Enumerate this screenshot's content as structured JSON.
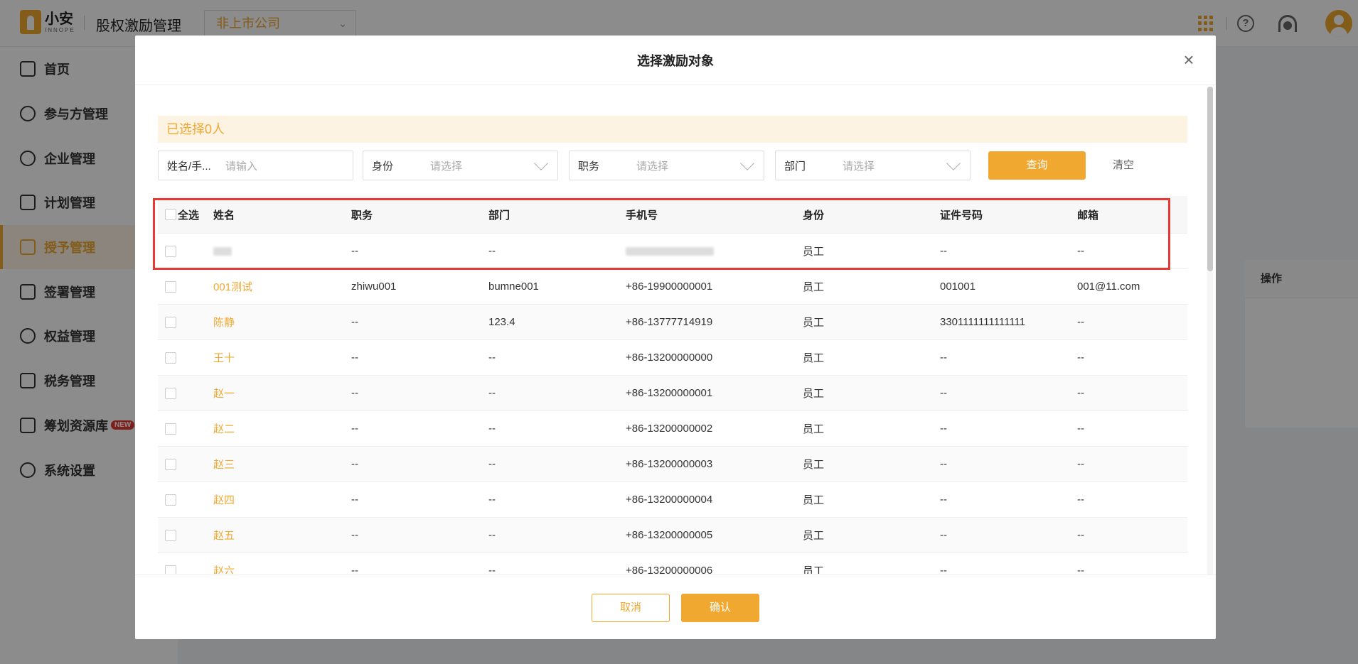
{
  "app": {
    "logo_cn": "小安",
    "logo_en": "INNOPE",
    "title": "股权激励管理",
    "company": "非上市公司"
  },
  "sidebar": {
    "items": [
      {
        "label": "首页"
      },
      {
        "label": "参与方管理"
      },
      {
        "label": "企业管理"
      },
      {
        "label": "计划管理"
      },
      {
        "label": "授予管理",
        "active": true
      },
      {
        "label": "签署管理"
      },
      {
        "label": "权益管理"
      },
      {
        "label": "税务管理"
      },
      {
        "label": "筹划资源库",
        "badge": "NEW"
      },
      {
        "label": "系统设置"
      }
    ]
  },
  "background": {
    "operation_header": "操作"
  },
  "modal": {
    "title": "选择激励对象",
    "selected_text": "已选择0人",
    "filters": {
      "name": {
        "label": "姓名/手...",
        "placeholder": "请输入"
      },
      "identity": {
        "label": "身份",
        "placeholder": "请选择"
      },
      "position": {
        "label": "职务",
        "placeholder": "请选择"
      },
      "department": {
        "label": "部门",
        "placeholder": "请选择"
      }
    },
    "query_button": "查询",
    "clear_button": "清空",
    "table": {
      "headers": {
        "select_all": "全选",
        "name": "姓名",
        "position": "职务",
        "department": "部门",
        "phone": "手机号",
        "identity": "身份",
        "id_number": "证件号码",
        "email": "邮箱"
      },
      "rows": [
        {
          "name": "",
          "position": "--",
          "department": "--",
          "phone": "",
          "identity": "员工",
          "id_number": "--",
          "email": "--",
          "redacted": true
        },
        {
          "name": "001测试",
          "position": "zhiwu001",
          "department": "bumne001",
          "phone": "+86-19900000001",
          "identity": "员工",
          "id_number": "001001",
          "email": "001@11.com"
        },
        {
          "name": "陈静",
          "position": "--",
          "department": "123.4",
          "phone": "+86-13777714919",
          "identity": "员工",
          "id_number": "3301111111111111",
          "email": "--"
        },
        {
          "name": "王十",
          "position": "--",
          "department": "--",
          "phone": "+86-13200000000",
          "identity": "员工",
          "id_number": "--",
          "email": "--"
        },
        {
          "name": "赵一",
          "position": "--",
          "department": "--",
          "phone": "+86-13200000001",
          "identity": "员工",
          "id_number": "--",
          "email": "--"
        },
        {
          "name": "赵二",
          "position": "--",
          "department": "--",
          "phone": "+86-13200000002",
          "identity": "员工",
          "id_number": "--",
          "email": "--"
        },
        {
          "name": "赵三",
          "position": "--",
          "department": "--",
          "phone": "+86-13200000003",
          "identity": "员工",
          "id_number": "--",
          "email": "--"
        },
        {
          "name": "赵四",
          "position": "--",
          "department": "--",
          "phone": "+86-13200000004",
          "identity": "员工",
          "id_number": "--",
          "email": "--"
        },
        {
          "name": "赵五",
          "position": "--",
          "department": "--",
          "phone": "+86-13200000005",
          "identity": "员工",
          "id_number": "--",
          "email": "--"
        },
        {
          "name": "赵六",
          "position": "--",
          "department": "--",
          "phone": "+86-13200000006",
          "identity": "员工",
          "id_number": "--",
          "email": "--"
        }
      ]
    },
    "cancel_button": "取消",
    "confirm_button": "确认"
  },
  "colors": {
    "accent": "#f0a830",
    "highlight": "#e53935"
  }
}
